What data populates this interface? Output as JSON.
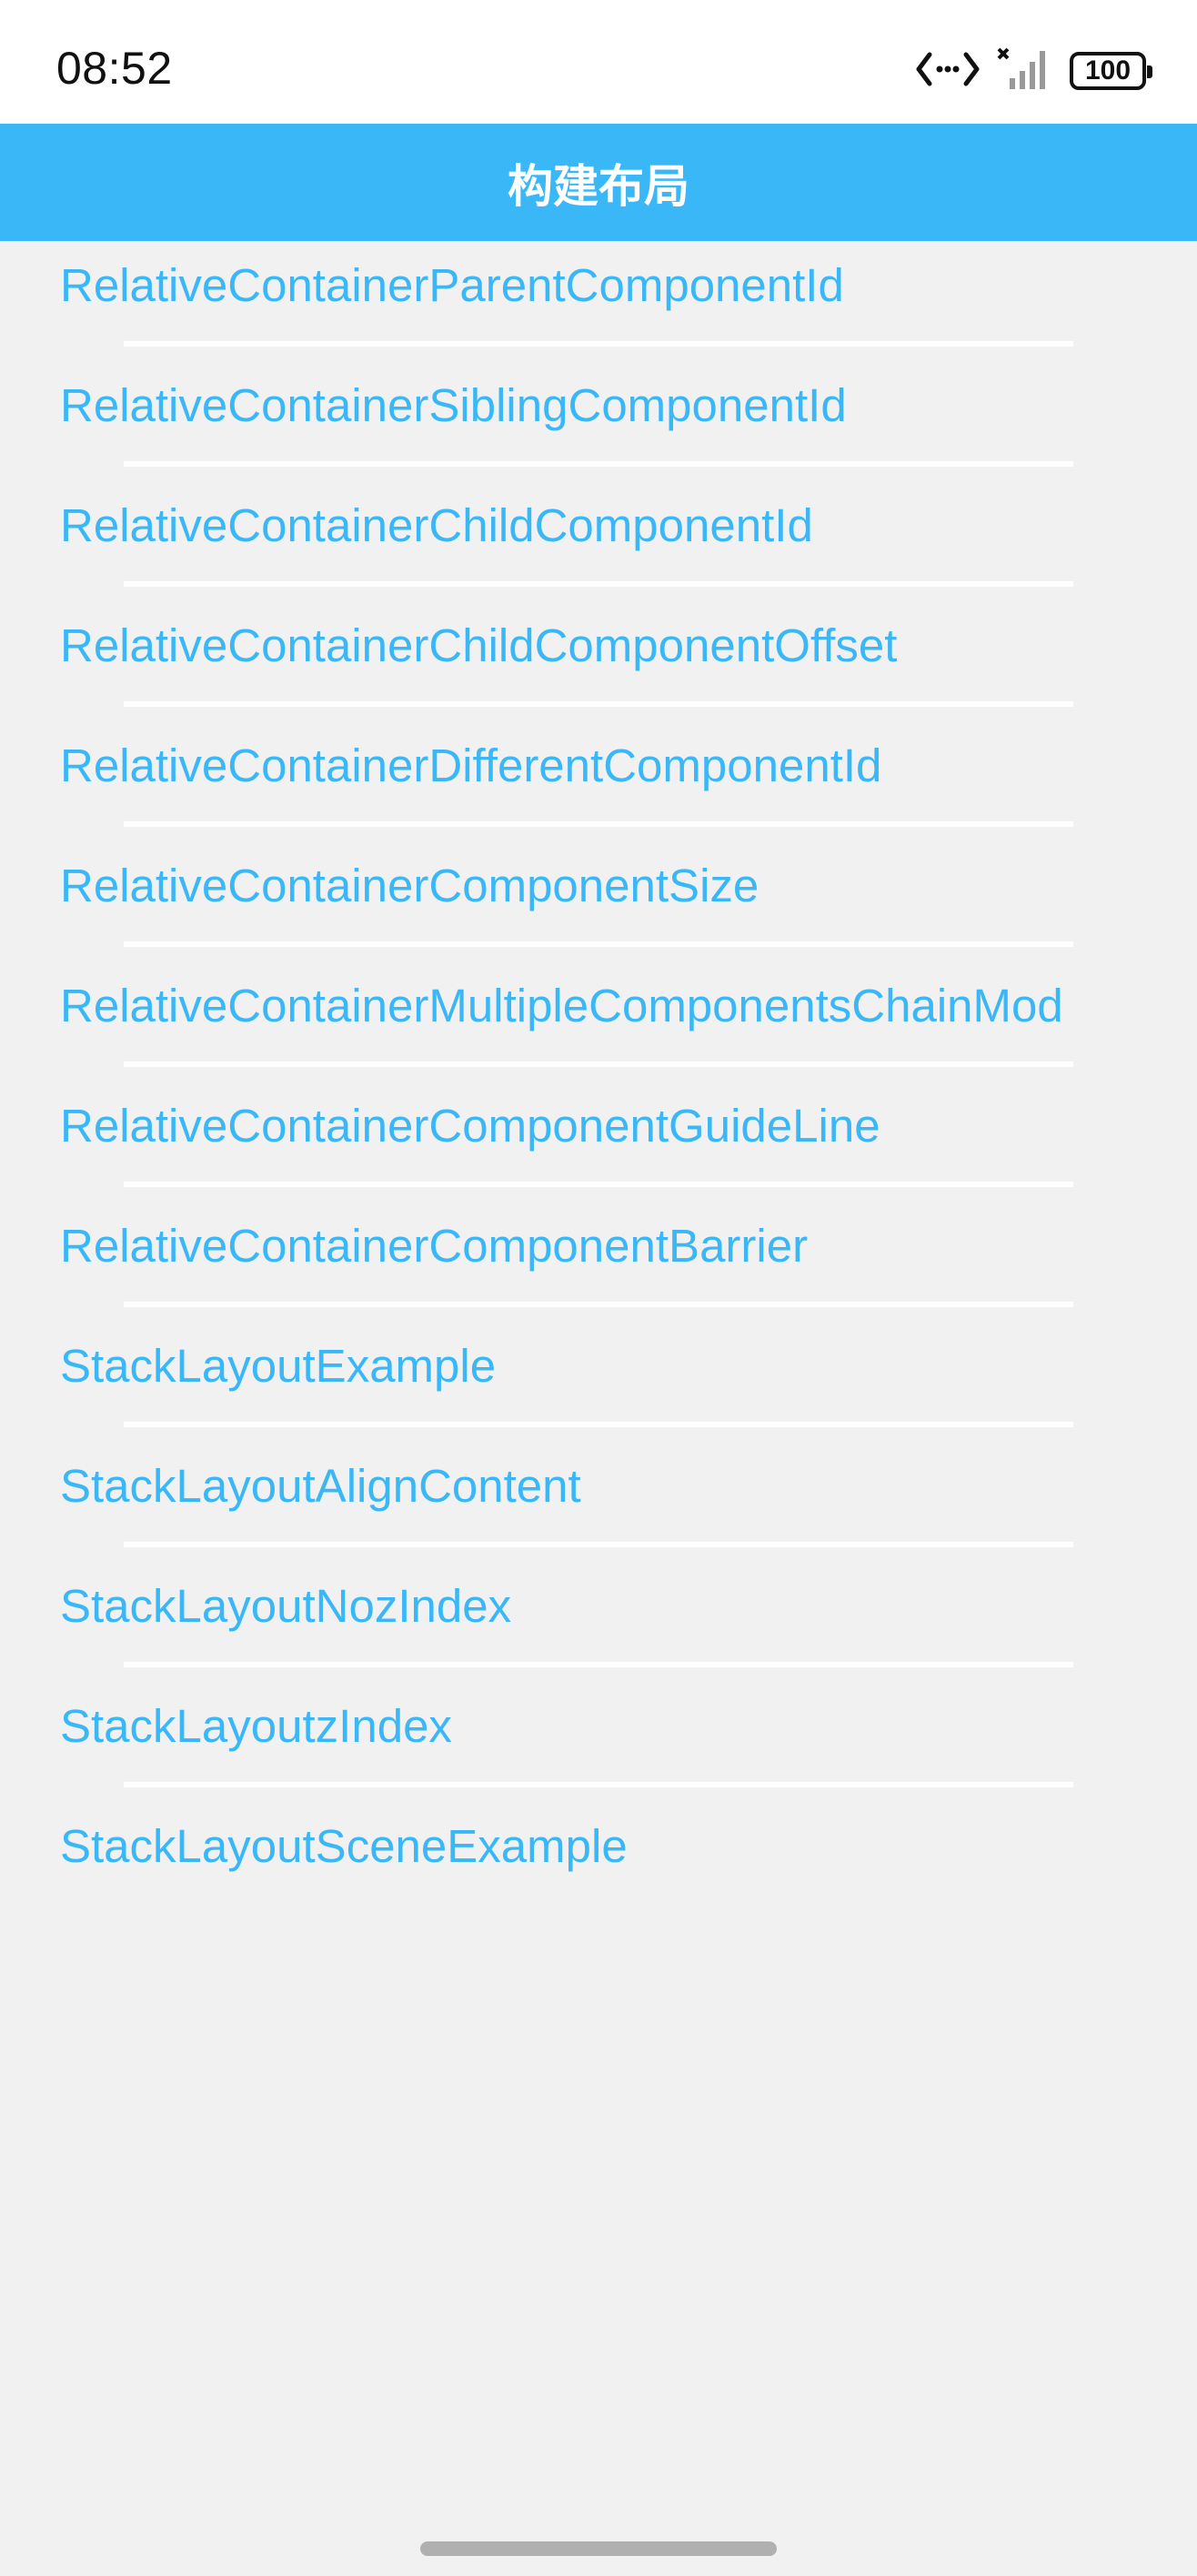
{
  "status_bar": {
    "time": "08:52",
    "battery": "100",
    "icons": [
      "data-transfer-icon",
      "signal-no-service-icon",
      "battery-icon"
    ]
  },
  "header": {
    "title": "构建布局"
  },
  "list": {
    "items": [
      {
        "label": "RelativeContainerParentComponentId"
      },
      {
        "label": "RelativeContainerSiblingComponentId"
      },
      {
        "label": "RelativeContainerChildComponentId"
      },
      {
        "label": "RelativeContainerChildComponentOffset"
      },
      {
        "label": "RelativeContainerDifferentComponentId"
      },
      {
        "label": "RelativeContainerComponentSize"
      },
      {
        "label": "RelativeContainerMultipleComponentsChainMod"
      },
      {
        "label": "RelativeContainerComponentGuideLine"
      },
      {
        "label": "RelativeContainerComponentBarrier"
      },
      {
        "label": "StackLayoutExample"
      },
      {
        "label": "StackLayoutAlignContent"
      },
      {
        "label": "StackLayoutNozIndex"
      },
      {
        "label": "StackLayoutzIndex"
      },
      {
        "label": "StackLayoutSceneExample"
      }
    ]
  },
  "colors": {
    "accent": "#39b7f7",
    "background": "#f1f1f1",
    "divider": "#ffffff"
  }
}
